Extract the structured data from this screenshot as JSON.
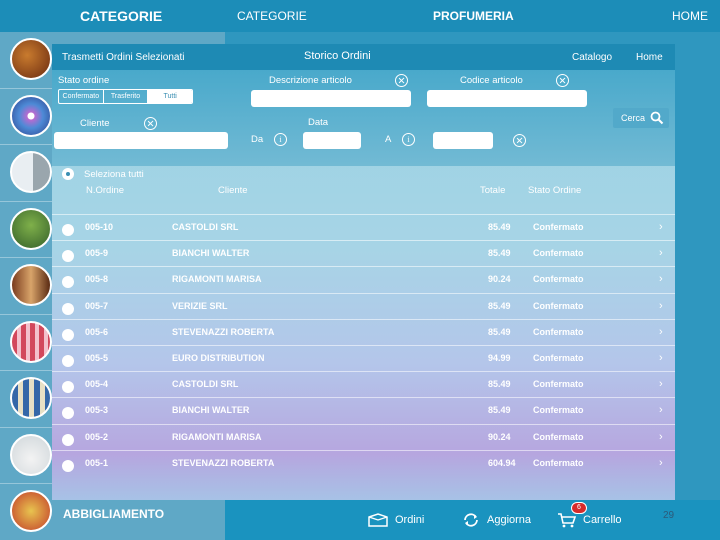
{
  "app": {
    "left_header": "CATEGORIE",
    "top_category": "CATEGORIE",
    "top_title": "PROFUMERIA",
    "top_home": "HOME",
    "category_last_label": "ABBIGLIAMENTO",
    "category_icons": [
      "liquor-bottles",
      "cd-disc",
      "appliance",
      "plants",
      "drinks",
      "cosmetics",
      "perfume-bottles",
      "wine-glass",
      "gifts"
    ]
  },
  "orders_panel": {
    "transmit_label": "Trasmetti Ordini Selezionati",
    "title": "Storico Ordini",
    "catalog_link": "Catalogo",
    "home_link": "Home",
    "filters": {
      "status_label": "Stato ordine",
      "status_options": [
        "Confermato",
        "Trasferito",
        "Tutti"
      ],
      "description_label": "Descrizione articolo",
      "code_label": "Codice articolo",
      "customer_label": "Cliente",
      "date_label": "Data",
      "from_label": "Da",
      "to_label": "A",
      "search_button": "Cerca"
    },
    "select_all": "Seleziona tutti",
    "columns": {
      "order_no": "N.Ordine",
      "customer": "Cliente",
      "total": "Totale",
      "status": "Stato Ordine"
    },
    "orders": [
      {
        "id": "005-10",
        "customer": "CASTOLDI SRL",
        "total": "85.49",
        "status": "Confermato"
      },
      {
        "id": "005-9",
        "customer": "BIANCHI WALTER",
        "total": "85.49",
        "status": "Confermato"
      },
      {
        "id": "005-8",
        "customer": "RIGAMONTI MARISA",
        "total": "90.24",
        "status": "Confermato"
      },
      {
        "id": "005-7",
        "customer": "VERIZIE SRL",
        "total": "85.49",
        "status": "Confermato"
      },
      {
        "id": "005-6",
        "customer": "STEVENAZZI ROBERTA",
        "total": "85.49",
        "status": "Confermato"
      },
      {
        "id": "005-5",
        "customer": "EURO DISTRIBUTION",
        "total": "94.99",
        "status": "Confermato"
      },
      {
        "id": "005-4",
        "customer": "CASTOLDI SRL",
        "total": "85.49",
        "status": "Confermato"
      },
      {
        "id": "005-3",
        "customer": "BIANCHI WALTER",
        "total": "85.49",
        "status": "Confermato"
      },
      {
        "id": "005-2",
        "customer": "RIGAMONTI MARISA",
        "total": "90.24",
        "status": "Confermato"
      },
      {
        "id": "005-1",
        "customer": "STEVENAZZI ROBERTA",
        "total": "604.94",
        "status": "Confermato"
      }
    ]
  },
  "bottom_bar": {
    "orders_label": "Ordini",
    "refresh_label": "Aggiorna",
    "cart_label": "Carrello",
    "cart_badge": "6",
    "page_number": "29"
  },
  "colors": {
    "primary": "#1c8db8",
    "sidebar": "#5fa8c6",
    "badge": "#d52b2b"
  }
}
